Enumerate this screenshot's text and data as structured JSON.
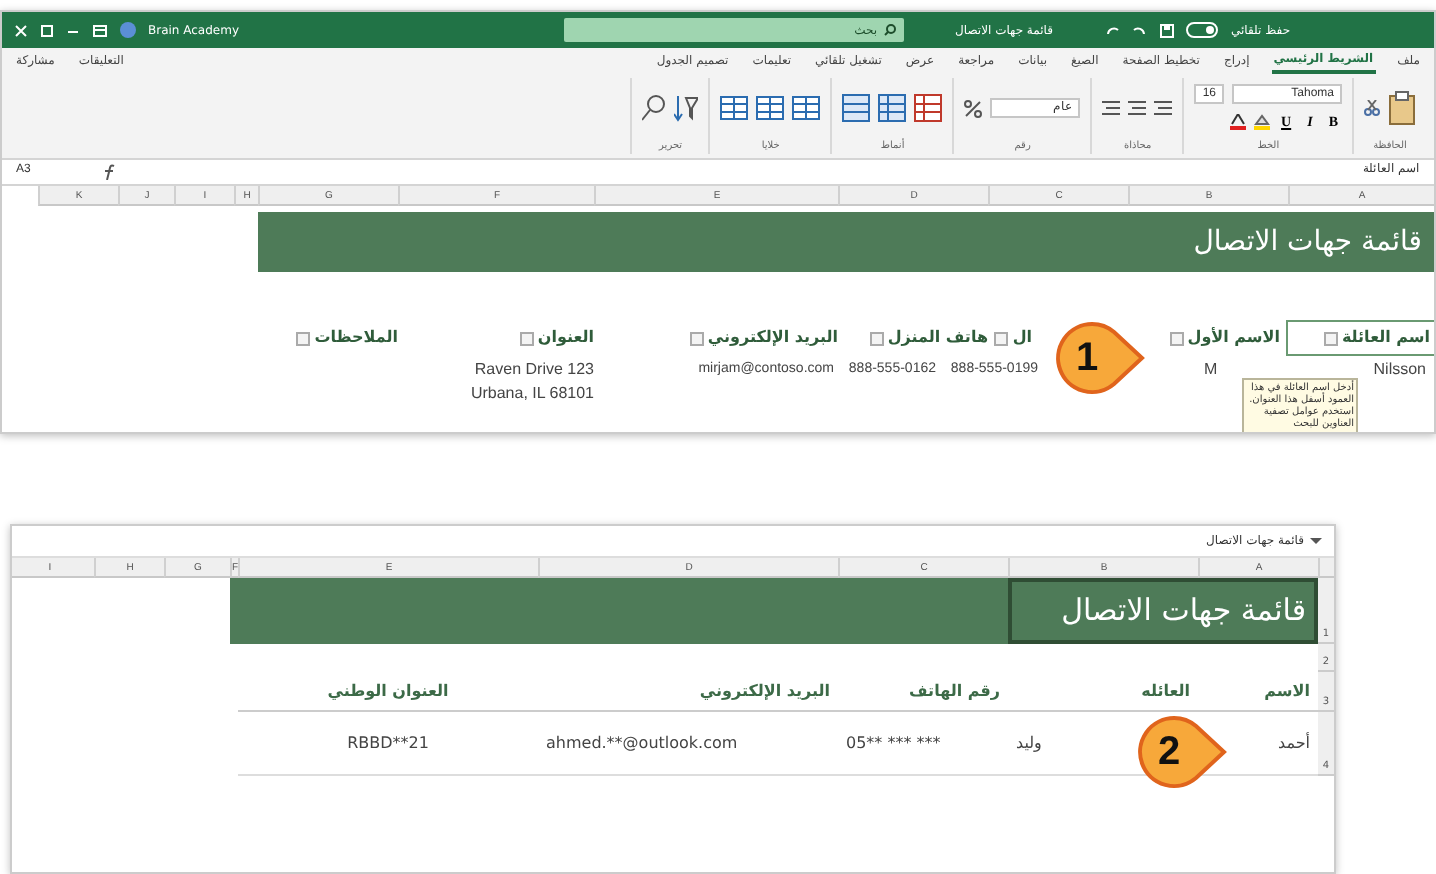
{
  "screenshot_1": {
    "title_bar": {
      "account": "Brain Academy",
      "search_placeholder": "بحث",
      "document_title": "قائمة جهات الاتصال",
      "autosave": "حفظ تلقائي"
    },
    "ribbon_tabs": [
      {
        "label": "ملف",
        "selected": false
      },
      {
        "label": "الشريط الرئيسي",
        "selected": true
      },
      {
        "label": "إدراج",
        "selected": false
      },
      {
        "label": "تخطيط الصفحة",
        "selected": false
      },
      {
        "label": "الصيغ",
        "selected": false
      },
      {
        "label": "بيانات",
        "selected": false
      },
      {
        "label": "مراجعة",
        "selected": false
      },
      {
        "label": "عرض",
        "selected": false
      },
      {
        "label": "تشغيل تلقائي",
        "selected": false
      },
      {
        "label": "تعليمات",
        "selected": false
      },
      {
        "label": "تصميم الجدول",
        "selected": false
      }
    ],
    "comments": "التعليقات",
    "share": "مشاركة",
    "font": {
      "name": "Tahoma",
      "size": "16"
    },
    "format_buttons": [
      "B",
      "I",
      "U"
    ],
    "number_format": "عام",
    "ribbon_groups": [
      "الحافظة",
      "الخط",
      "محاذاة",
      "رقم",
      "أنماط",
      "خلايا",
      "تحرير"
    ],
    "name_box": "A3",
    "formula": "اسم العائلة",
    "columns": [
      "A",
      "B",
      "C",
      "D",
      "E",
      "F",
      "G",
      "H",
      "I",
      "J",
      "K"
    ],
    "sheet_title": "قائمة جهات الاتصال",
    "headers": [
      "اسم العائلة",
      "الاسم الأول",
      "ال",
      "هاتف المنزل",
      "البريد الإلكتروني",
      "العنوان",
      "الملاحظات"
    ],
    "row": [
      "Nilsson",
      "M",
      "888-555-0199",
      "888-555-0162",
      "mirjam@contoso.com",
      [
        "Raven Drive 123",
        "Urbana, IL 68101"
      ]
    ],
    "tooltip": "أدخل اسم العائلة في هذا العمود أسفل هذا العنوان. استخدم عوامل تصفية العناوين للبحث",
    "callout": "1"
  },
  "screenshot_2": {
    "name_box": "قائمة جهات الاتصال",
    "columns": [
      "A",
      "B",
      "C",
      "D",
      "E",
      "F",
      "G",
      "H",
      "I"
    ],
    "row_numbers": [
      "1",
      "2",
      "3",
      "4"
    ],
    "sheet_title": "قائمة جهات الاتصال",
    "headers": [
      "الاسم",
      "العائله",
      "رقم الهاتف",
      "البريد الإلكتروني",
      "العنوان الوطني"
    ],
    "row": [
      "أحمد",
      "وليد",
      "05** *** ***",
      "ahmed.**@outlook.com",
      "RBBD**21"
    ],
    "callout": "2"
  }
}
